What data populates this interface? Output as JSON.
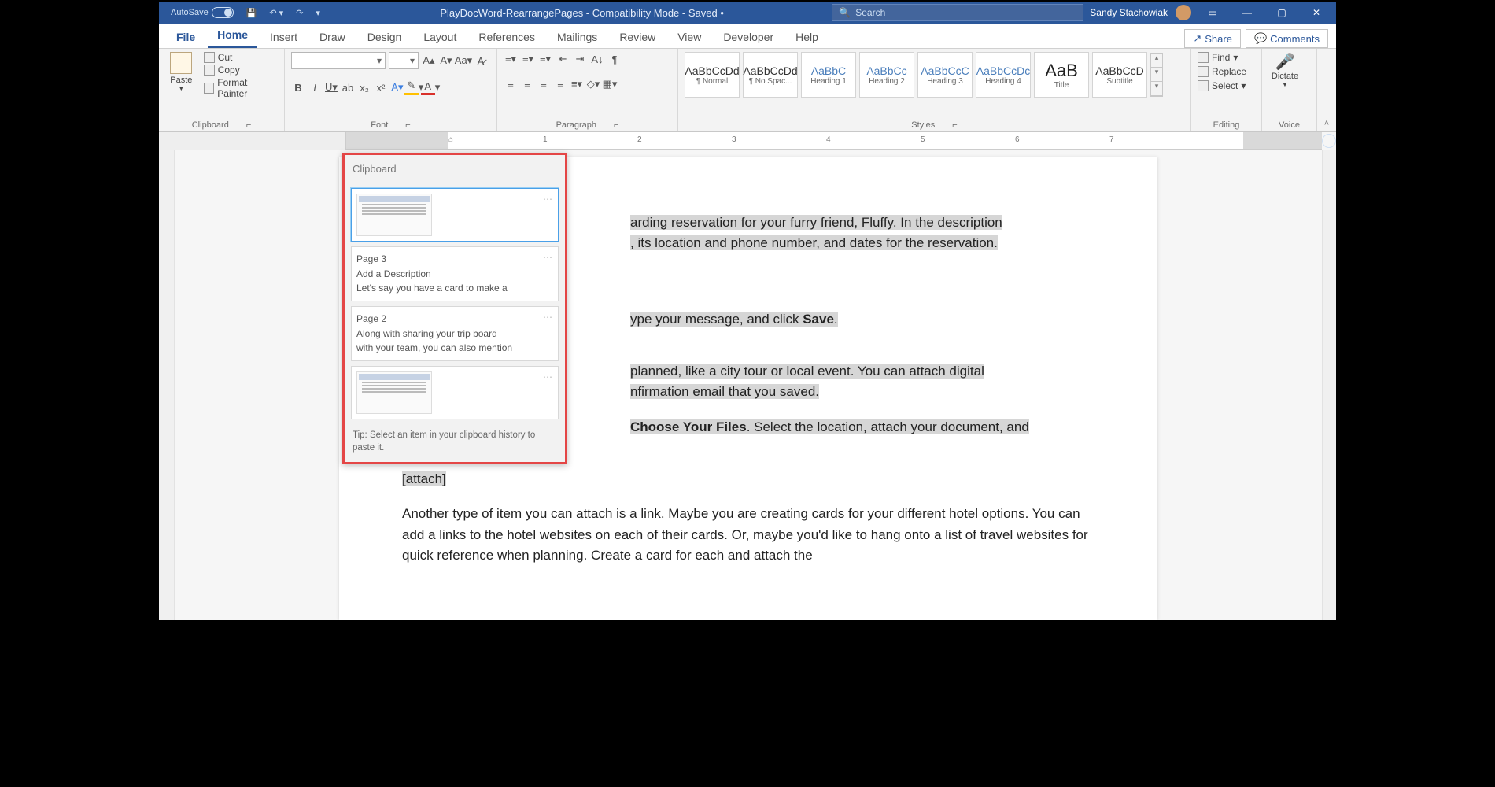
{
  "titlebar": {
    "autosave_label": "AutoSave",
    "doc_title": "PlayDocWord-RearrangePages  -  Compatibility Mode  -  Saved  •",
    "search_placeholder": "Search",
    "user_name": "Sandy Stachowiak"
  },
  "tabs": {
    "items": [
      "File",
      "Home",
      "Insert",
      "Draw",
      "Design",
      "Layout",
      "References",
      "Mailings",
      "Review",
      "View",
      "Developer",
      "Help"
    ],
    "active": "Home",
    "share": "Share",
    "comments": "Comments"
  },
  "ribbon": {
    "clipboard": {
      "paste": "Paste",
      "cut": "Cut",
      "copy": "Copy",
      "format_painter": "Format Painter",
      "label": "Clipboard"
    },
    "font": {
      "label": "Font"
    },
    "paragraph": {
      "label": "Paragraph"
    },
    "styles": {
      "items": [
        {
          "preview": "AaBbCcDd",
          "name": "¶ Normal"
        },
        {
          "preview": "AaBbCcDd",
          "name": "¶ No Spac..."
        },
        {
          "preview": "AaBbC",
          "name": "Heading 1",
          "blue": true
        },
        {
          "preview": "AaBbCc",
          "name": "Heading 2",
          "blue": true
        },
        {
          "preview": "AaBbCcC",
          "name": "Heading 3",
          "blue": true
        },
        {
          "preview": "AaBbCcDc",
          "name": "Heading 4",
          "blue": true
        },
        {
          "preview": "AaB",
          "name": "Title",
          "title": true
        },
        {
          "preview": "AaBbCcD",
          "name": "Subtitle"
        }
      ],
      "label": "Styles"
    },
    "editing": {
      "find": "Find",
      "replace": "Replace",
      "select": "Select",
      "label": "Editing"
    },
    "voice": {
      "dictate": "Dictate",
      "label": "Voice"
    }
  },
  "ruler_numbers": [
    "1",
    "2",
    "3",
    "4",
    "5",
    "6",
    "7"
  ],
  "document": {
    "p1a": "arding reservation for your furry friend, Fluffy. In the description",
    "p1b": ", its location and phone number, and dates for the reservation.",
    "p2a": "ype your message, and click ",
    "p2b": "Save",
    "p2c": ".",
    "p3a": " planned, like a city tour or local event. You can attach digital",
    "p3b": "nfirmation email that you saved.",
    "p4a": "Choose Your Files",
    "p4b": ". Select the location, attach your document, and",
    "attach": "[attach]",
    "p5": "Another type of item you can attach is a link. Maybe you are creating cards for your different hotel options. You can add a links to the hotel websites on each of their cards. Or, maybe you'd like to hang onto a list of travel websites for quick reference when planning. Create a card for each and attach the"
  },
  "clipboard_popup": {
    "title": "Clipboard",
    "item2": {
      "l1": "Page 3",
      "l2": "Add a Description",
      "l3": "Let's say you have a card to make a"
    },
    "item3": {
      "l1": "Page 2",
      "l2": "Along with sharing your trip board",
      "l3": "with your team, you can also mention"
    },
    "tip": "Tip: Select an item in your clipboard history to paste it."
  }
}
